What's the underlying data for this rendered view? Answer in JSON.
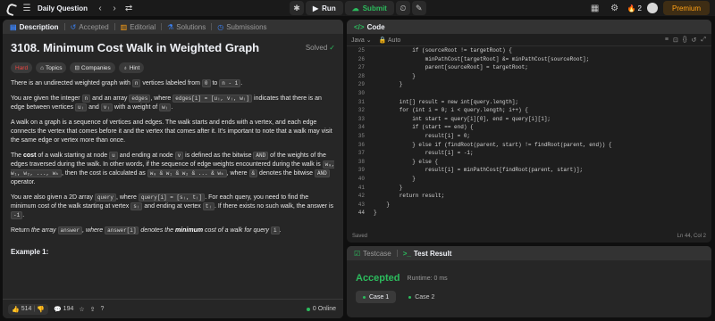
{
  "topbar": {
    "problem_list_title": "Daily Question",
    "run_label": "Run",
    "submit_label": "Submit",
    "streak_count": "2",
    "premium_label": "Premium"
  },
  "left": {
    "tabs": [
      {
        "label": "Description",
        "icon": "description-icon"
      },
      {
        "label": "Accepted",
        "icon": "history-icon"
      },
      {
        "label": "Editorial",
        "icon": "book-icon"
      },
      {
        "label": "Solutions",
        "icon": "flask-icon"
      },
      {
        "label": "Submissions",
        "icon": "clock-icon"
      }
    ],
    "title": "3108. Minimum Cost Walk in Weighted Graph",
    "solved": "Solved",
    "chips": {
      "difficulty": "Hard",
      "topics": "Topics",
      "companies": "Companies",
      "hint": "Hint"
    },
    "p1": {
      "a": "There is an undirected weighted graph with ",
      "c1": "n",
      "b": " vertices labeled from ",
      "c2": "0",
      "c": " to ",
      "c3": "n - 1",
      "d": "."
    },
    "p2": {
      "a": "You are given the integer ",
      "c1": "n",
      "b": " and an array ",
      "c2": "edges",
      "c": ", where ",
      "c3": "edges[i] = [uᵢ, vᵢ, wᵢ]",
      "d": " indicates that there is an edge between vertices ",
      "c4": "uᵢ",
      "e": " and ",
      "c5": "vᵢ",
      "f": " with a weight of ",
      "c6": "wᵢ",
      "g": "."
    },
    "p3": "A walk on a graph is a sequence of vertices and edges. The walk starts and ends with a vertex, and each edge connects the vertex that comes before it and the vertex that comes after it. It's important to note that a walk may visit the same edge or vertex more than once.",
    "p4": {
      "a": "The ",
      "b": "cost",
      "c": " of a walk starting at node ",
      "c1": "u",
      "d": " and ending at node ",
      "c2": "v",
      "e": " is defined as the bitwise ",
      "c3": "AND",
      "f": " of the weights of the edges traversed during the walk. In other words, if the sequence of edge weights encountered during the walk is ",
      "c4": "w₀, w₁, w₂, ..., wₖ",
      "g": ", then the cost is calculated as ",
      "c5": "w₀ & w₁ & w₂ & ... & wₖ",
      "h": ", where ",
      "c6": "&",
      "i": " denotes the bitwise ",
      "c7": "AND",
      "j": " operator."
    },
    "p5": {
      "a": "You are also given a 2D array ",
      "c1": "query",
      "b": ", where ",
      "c2": "query[i] = [sᵢ, tᵢ]",
      "c": ". For each query, you need to find the minimum cost of the walk starting at vertex ",
      "c3": "sᵢ",
      "d": " and ending at vertex ",
      "c4": "tᵢ",
      "e": ". If there exists no such walk, the answer is ",
      "c5": "-1",
      "f": "."
    },
    "p6": {
      "a": "Return ",
      "b": "the array ",
      "c1": "answer",
      "c": ", where ",
      "c2": "answer[i]",
      "d": " denotes the ",
      "e": "minimum",
      "f": " cost of a walk for query ",
      "c3": "i",
      "g": "."
    },
    "example_heading": "Example 1:",
    "footer": {
      "likes": "514",
      "comments": "194",
      "online": "0 Online"
    }
  },
  "code": {
    "tab_label": "Code",
    "language": "Java",
    "mode": "Auto",
    "lines": [
      {
        "n": "25",
        "t": "            if (sourceRoot != targetRoot) {"
      },
      {
        "n": "26",
        "t": "                minPathCost[targetRoot] &= minPathCost[sourceRoot];"
      },
      {
        "n": "27",
        "t": "                parent[sourceRoot] = targetRoot;"
      },
      {
        "n": "28",
        "t": "            }"
      },
      {
        "n": "29",
        "t": "        }"
      },
      {
        "n": "30",
        "t": ""
      },
      {
        "n": "31",
        "t": "        int[] result = new int[query.length];"
      },
      {
        "n": "32",
        "t": "        for (int i = 0; i < query.length; i++) {"
      },
      {
        "n": "33",
        "t": "            int start = query[i][0], end = query[i][1];"
      },
      {
        "n": "34",
        "t": "            if (start == end) {"
      },
      {
        "n": "35",
        "t": "                result[i] = 0;"
      },
      {
        "n": "36",
        "t": "            } else if (findRoot(parent, start) != findRoot(parent, end)) {"
      },
      {
        "n": "37",
        "t": "                result[i] = -1;"
      },
      {
        "n": "38",
        "t": "            } else {"
      },
      {
        "n": "39",
        "t": "                result[i] = minPathCost[findRoot(parent, start)];"
      },
      {
        "n": "40",
        "t": "            }"
      },
      {
        "n": "41",
        "t": "        }"
      },
      {
        "n": "42",
        "t": "        return result;"
      },
      {
        "n": "43",
        "t": "    }"
      },
      {
        "n": "44",
        "t": "}"
      }
    ],
    "saved": "Saved",
    "cursor": "Ln 44, Col 2"
  },
  "result": {
    "tabs": [
      {
        "label": "Testcase"
      },
      {
        "label": "Test Result"
      }
    ],
    "status": "Accepted",
    "runtime": "Runtime: 0 ms",
    "cases": [
      "Case 1",
      "Case 2"
    ]
  },
  "colors": {
    "accepted": "#2cbb5d",
    "hard": "#ef4743",
    "premium": "#ffa116"
  }
}
